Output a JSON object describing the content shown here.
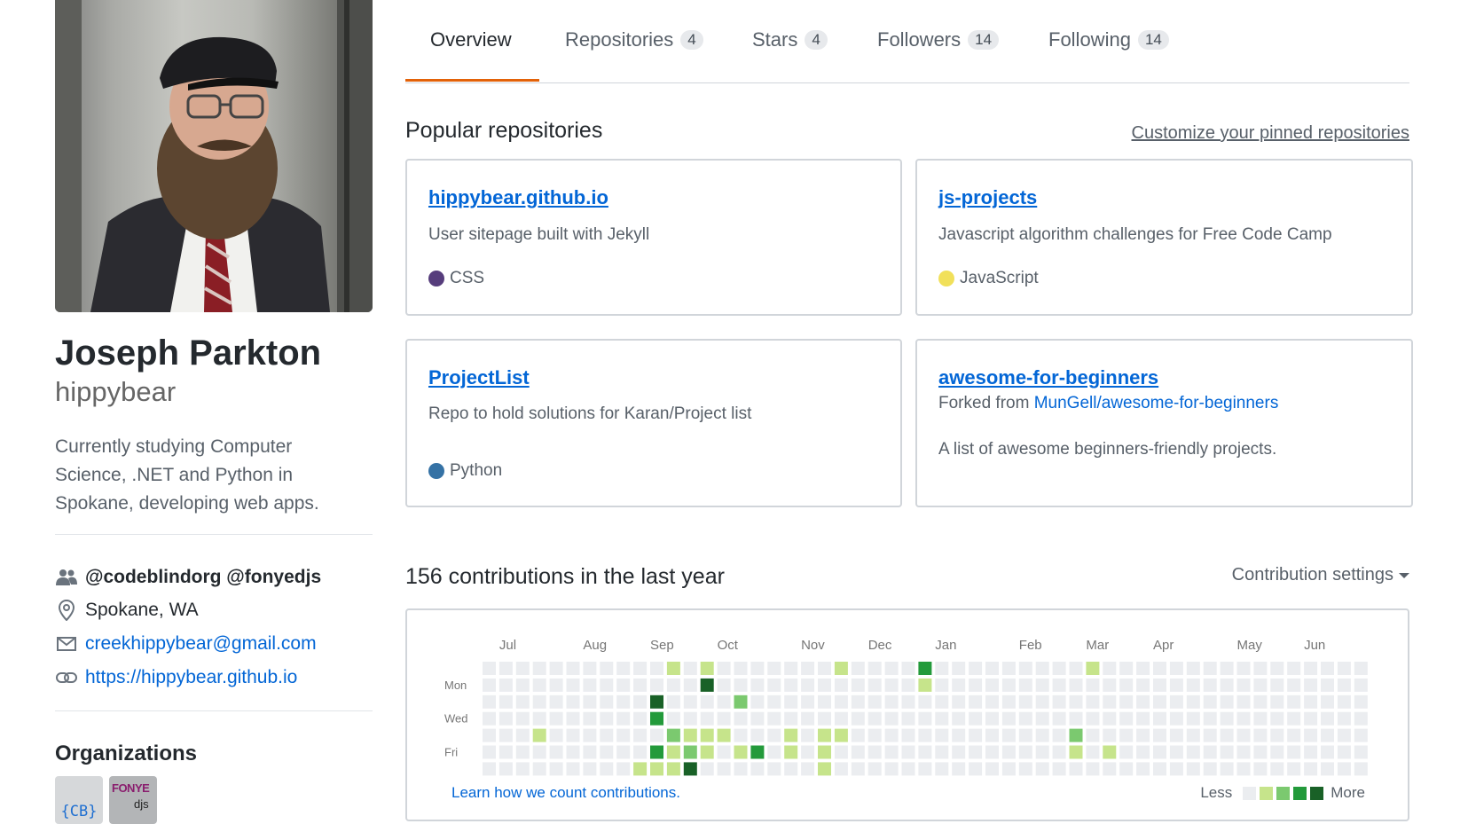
{
  "profile": {
    "name": "Joseph Parkton",
    "username": "hippybear",
    "bio": "Currently studying Computer Science, .NET and Python in Spokane, developing web apps.",
    "company": "@codeblindorg @fonyedjs",
    "location": "Spokane, WA",
    "email": "creekhippybear@gmail.com",
    "website": "https://hippybear.github.io",
    "organizations_title": "Organizations",
    "organizations": [
      {
        "label": "{CB}"
      },
      {
        "label_top": "FONYE",
        "label_bottom": "djs"
      }
    ]
  },
  "tabs": [
    {
      "label": "Overview",
      "count": null,
      "selected": true
    },
    {
      "label": "Repositories",
      "count": "4"
    },
    {
      "label": "Stars",
      "count": "4"
    },
    {
      "label": "Followers",
      "count": "14"
    },
    {
      "label": "Following",
      "count": "14"
    }
  ],
  "popular": {
    "title": "Popular repositories",
    "customize": "Customize your pinned repositories",
    "repos": [
      {
        "name": "hippybear.github.io",
        "description": "User sitepage built with Jekyll",
        "language": "CSS",
        "lang_color": "#563d7c"
      },
      {
        "name": "js-projects",
        "description": "Javascript algorithm challenges for Free Code Camp",
        "language": "JavaScript",
        "lang_color": "#f1e05a"
      },
      {
        "name": "ProjectList",
        "description": "Repo to hold solutions for Karan/Project list",
        "language": "Python",
        "lang_color": "#3572A5"
      },
      {
        "name": "awesome-for-beginners",
        "forked_prefix": "Forked from",
        "forked_from": "MunGell/awesome-for-beginners",
        "description": "A list of awesome beginners-friendly projects."
      }
    ]
  },
  "contributions": {
    "title": "156 contributions in the last year",
    "settings": "Contribution settings",
    "months": [
      "Jul",
      "Aug",
      "Sep",
      "Oct",
      "Nov",
      "Dec",
      "Jan",
      "Feb",
      "Mar",
      "Apr",
      "May",
      "Jun"
    ],
    "month_weeks": [
      1,
      6,
      10,
      14,
      19,
      23,
      27,
      32,
      36,
      40,
      45,
      49
    ],
    "day_labels": [
      "",
      "Mon",
      "",
      "Wed",
      "",
      "Fri",
      ""
    ],
    "learn_link": "Learn how we count contributions.",
    "legend_less": "Less",
    "legend_more": "More",
    "colors": [
      "#ebedf0",
      "#c6e48b",
      "#7bc96f",
      "#239a3b",
      "#196127"
    ],
    "weeks": 53,
    "active": [
      [
        3,
        4,
        1
      ],
      [
        9,
        6,
        1
      ],
      [
        10,
        2,
        4
      ],
      [
        10,
        3,
        3
      ],
      [
        10,
        5,
        3
      ],
      [
        10,
        6,
        1
      ],
      [
        11,
        0,
        1
      ],
      [
        11,
        4,
        2
      ],
      [
        11,
        5,
        1
      ],
      [
        11,
        6,
        1
      ],
      [
        12,
        4,
        1
      ],
      [
        12,
        5,
        2
      ],
      [
        12,
        6,
        4
      ],
      [
        13,
        0,
        1
      ],
      [
        13,
        1,
        4
      ],
      [
        13,
        4,
        1
      ],
      [
        13,
        5,
        1
      ],
      [
        14,
        4,
        1
      ],
      [
        15,
        2,
        2
      ],
      [
        15,
        5,
        1
      ],
      [
        16,
        5,
        3
      ],
      [
        18,
        4,
        1
      ],
      [
        18,
        5,
        1
      ],
      [
        20,
        4,
        1
      ],
      [
        20,
        5,
        1
      ],
      [
        20,
        6,
        1
      ],
      [
        21,
        0,
        1
      ],
      [
        21,
        4,
        1
      ],
      [
        26,
        0,
        3
      ],
      [
        26,
        1,
        1
      ],
      [
        35,
        4,
        2
      ],
      [
        35,
        5,
        1
      ],
      [
        36,
        0,
        1
      ],
      [
        37,
        5,
        1
      ]
    ]
  }
}
